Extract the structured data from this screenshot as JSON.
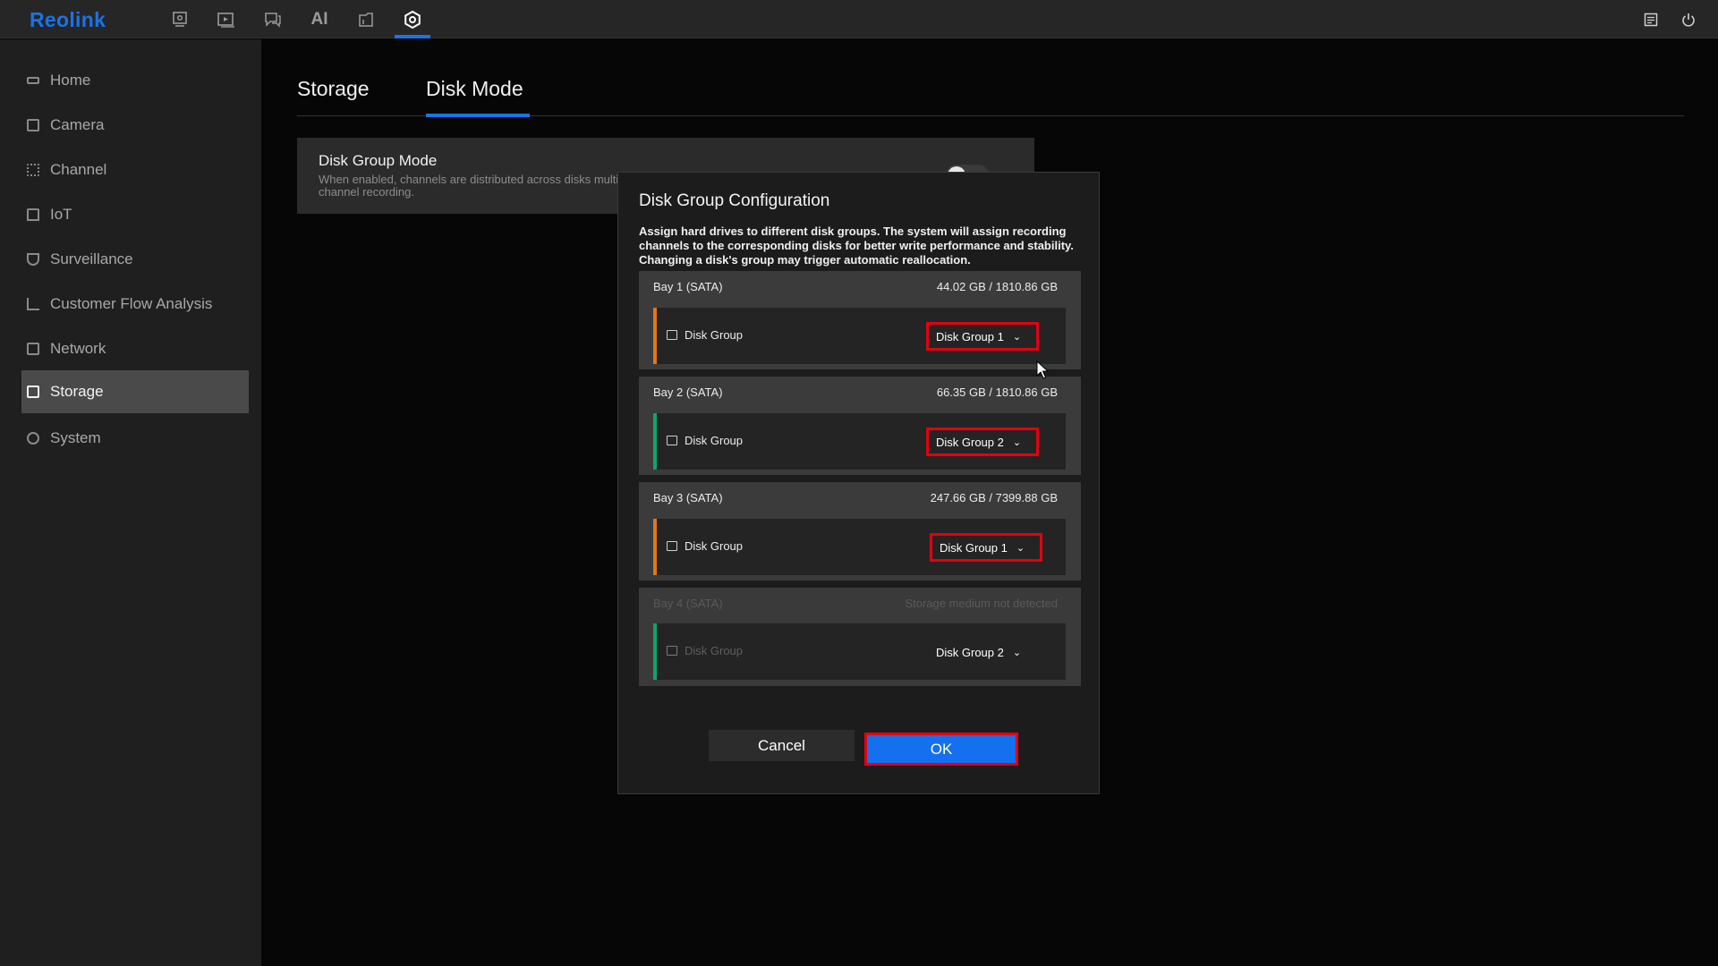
{
  "app": {
    "logo": "Reolink"
  },
  "topnav": {
    "icons": [
      "live-view-icon",
      "playback-icon",
      "messages-icon",
      "ai-icon",
      "files-icon",
      "settings-icon"
    ],
    "ai_label": "AI",
    "right_icons": [
      "notes-icon",
      "power-icon"
    ]
  },
  "sidebar": {
    "items": [
      {
        "label": "Home",
        "icon": "home-icon"
      },
      {
        "label": "Camera",
        "icon": "camera-icon"
      },
      {
        "label": "Channel",
        "icon": "channel-icon"
      },
      {
        "label": "IoT",
        "icon": "iot-icon"
      },
      {
        "label": "Surveillance",
        "icon": "shield-icon"
      },
      {
        "label": "Customer Flow Analysis",
        "icon": "chart-icon"
      },
      {
        "label": "Network",
        "icon": "network-icon"
      },
      {
        "label": "Storage",
        "icon": "storage-icon",
        "active": true
      },
      {
        "label": "System",
        "icon": "gear-icon"
      }
    ]
  },
  "tabs": [
    {
      "label": "Storage"
    },
    {
      "label": "Disk Mode",
      "active": true
    }
  ],
  "disk_group_mode": {
    "title": "Disk Group Mode",
    "description": "When enabled, channels are distributed across disks multi-channel recording."
  },
  "dialog": {
    "title": "Disk Group Configuration",
    "description": "Assign hard drives to different disk groups. The system will assign recording channels to the corresponding disks for better write performance and stability. Changing a disk's group may trigger automatic reallocation.",
    "bays": [
      {
        "name": "Bay 1 (SATA)",
        "capacity": "44.02 GB / 1810.86 GB",
        "row_label": "Disk Group",
        "group": "Disk Group 1",
        "stripe_color": "#e0761b"
      },
      {
        "name": "Bay 2 (SATA)",
        "capacity": "66.35 GB / 1810.86 GB",
        "row_label": "Disk Group",
        "group": "Disk Group 2",
        "stripe_color": "#13a36a"
      },
      {
        "name": "Bay 3 (SATA)",
        "capacity": "247.66 GB / 7399.88 GB",
        "row_label": "Disk Group",
        "group": "Disk Group 1",
        "stripe_color": "#e0761b"
      },
      {
        "name": "Bay 4 (SATA)",
        "capacity": "Storage medium not detected",
        "row_label": "Disk Group",
        "group": "Disk Group 2",
        "stripe_color": "#13a36a",
        "disabled": true
      }
    ],
    "cancel_label": "Cancel",
    "ok_label": "OK"
  }
}
